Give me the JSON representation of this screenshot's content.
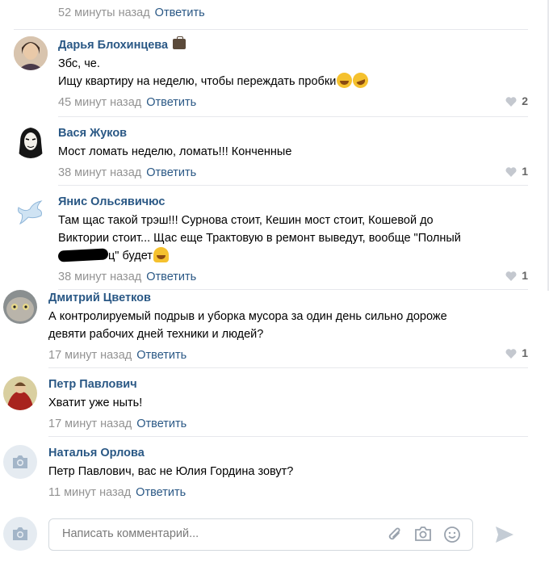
{
  "top": {
    "time": "52 минуты назад",
    "reply": "Ответить"
  },
  "comments": [
    {
      "author": "Дарья Блохинцева",
      "lines": [
        "Збс, че.",
        "Ищу квартиру на неделю, чтобы переждать пробки"
      ],
      "time": "45 минут назад",
      "reply": "Ответить",
      "likes": "2"
    },
    {
      "author": "Вася Жуков",
      "lines": [
        "Мост ломать неделю, ломать!!! Конченные"
      ],
      "time": "38 минут назад",
      "reply": "Ответить",
      "likes": "1"
    },
    {
      "author": "Янис Ольсявичюс",
      "lines": [
        "Там щас такой трэш!!! Сурнова стоит, Кешин мост стоит, Кошевой до",
        "Виктории стоит... Щас еще Трактовую в ремонт выведут, вообще \"Полный",
        "ц\" будет"
      ],
      "time": "38 минут назад",
      "reply": "Ответить",
      "likes": "1"
    },
    {
      "author": "Дмитрий Цветков",
      "lines": [
        "А контролируемый подрыв и уборка мусора за один день сильно дороже",
        "девяти рабочих дней техники и людей?"
      ],
      "time": "17 минут назад",
      "reply": "Ответить",
      "likes": "1"
    },
    {
      "author": "Петр Павлович",
      "lines": [
        "Хватит уже ныть!"
      ],
      "time": "17 минут назад",
      "reply": "Ответить"
    },
    {
      "author": "Наталья Орлова",
      "lines": [
        "Петр Павлович, вас не Юлия Гордина зовут?"
      ],
      "time": "11 минут назад",
      "reply": "Ответить"
    }
  ],
  "composer": {
    "placeholder": "Написать комментарий..."
  },
  "icons": {
    "attach": "paperclip-icon",
    "photo": "camera-icon",
    "emoji": "smiley-icon",
    "send": "send-arrow-icon",
    "like": "heart-icon"
  },
  "colors": {
    "link": "#2a5885",
    "meta": "#939393",
    "divider": "#e7e8ec"
  }
}
